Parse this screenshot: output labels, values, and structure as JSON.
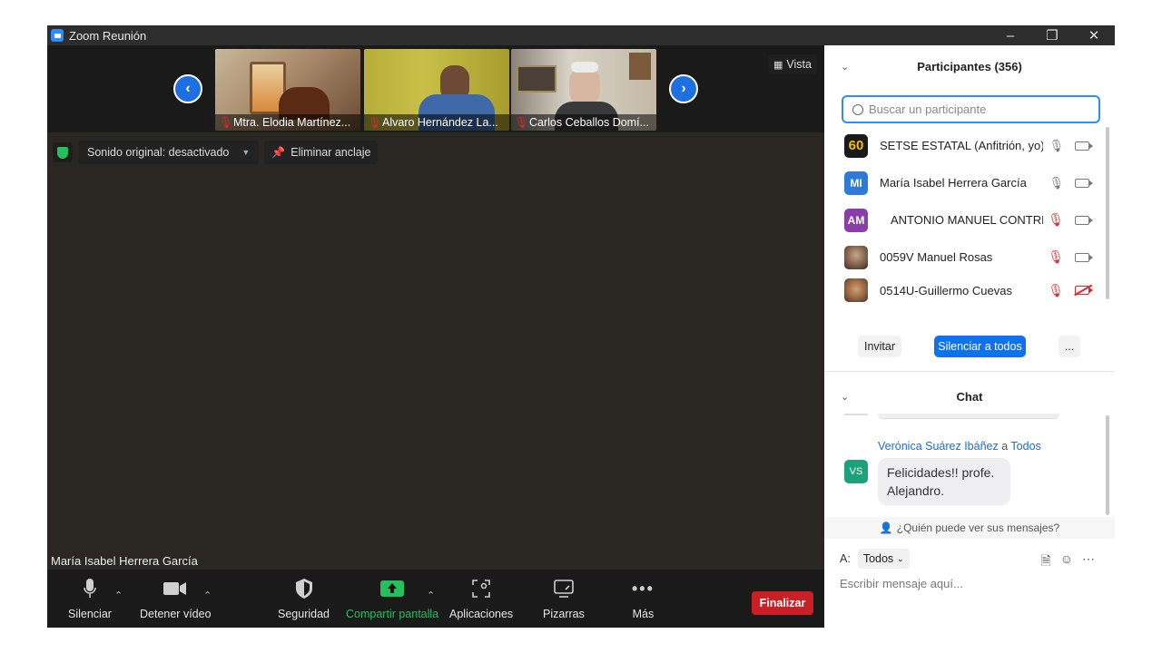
{
  "window": {
    "title": "Zoom Reunión"
  },
  "thumbnails": [
    {
      "name": "Mtra. Elodia Martínez..."
    },
    {
      "name": "Alvaro Hernández La..."
    },
    {
      "name": "Carlos Ceballos Domí..."
    }
  ],
  "view_button": {
    "label": "Vista"
  },
  "options": {
    "sound": "Sonido original: desactivado",
    "unpin": "Eliminar anclaje"
  },
  "active_speaker": "María Isabel Herrera García",
  "toolbar": {
    "mute": "Silenciar",
    "video": "Detener vídeo",
    "security": "Seguridad",
    "share": "Compartir pantalla",
    "apps": "Aplicaciones",
    "whiteboards": "Pizarras",
    "more": "Más",
    "end": "Finalizar"
  },
  "participants": {
    "header": "Participantes (356)",
    "search_placeholder": "Buscar un participante",
    "list": [
      {
        "name": "SETSE ESTATAL (Anfitrión, yo)",
        "avatar": "60",
        "color": "#1a1a1a",
        "muted": false,
        "camera_off": false
      },
      {
        "name": "María Isabel Herrera García",
        "avatar": "MI",
        "color": "#2e7bd6",
        "muted": false,
        "camera_off": false
      },
      {
        "name": "ANTONIO MANUEL CONTRE...",
        "avatar": "AM",
        "color": "#8a3fa8",
        "muted": true,
        "camera_off": false
      },
      {
        "name": "0059V Manuel Rosas",
        "avatar": "",
        "color": "#7a5a45",
        "muted": true,
        "camera_off": false
      },
      {
        "name": "0514U-Guillermo Cuevas",
        "avatar": "",
        "color": "#8a6040",
        "muted": true,
        "camera_off": true
      }
    ],
    "invite": "Invitar",
    "mute_all": "Silenciar a todos",
    "more": "..."
  },
  "chat": {
    "header": "Chat",
    "sender": "Verónica Suárez Ibáñez",
    "to_word": "a",
    "recipient": "Todos",
    "sender_initials": "VS",
    "message": "Felicidades!! profe. Alejandro.",
    "who_can_see": "¿Quién puede ver sus mensajes?",
    "to_label": "A:",
    "to_value": "Todos",
    "compose_placeholder": "Escribir mensaje aquí..."
  },
  "colors": {
    "accent": "#2d8cff",
    "end_button": "#cb1f26",
    "share_green": "#24c05e"
  }
}
